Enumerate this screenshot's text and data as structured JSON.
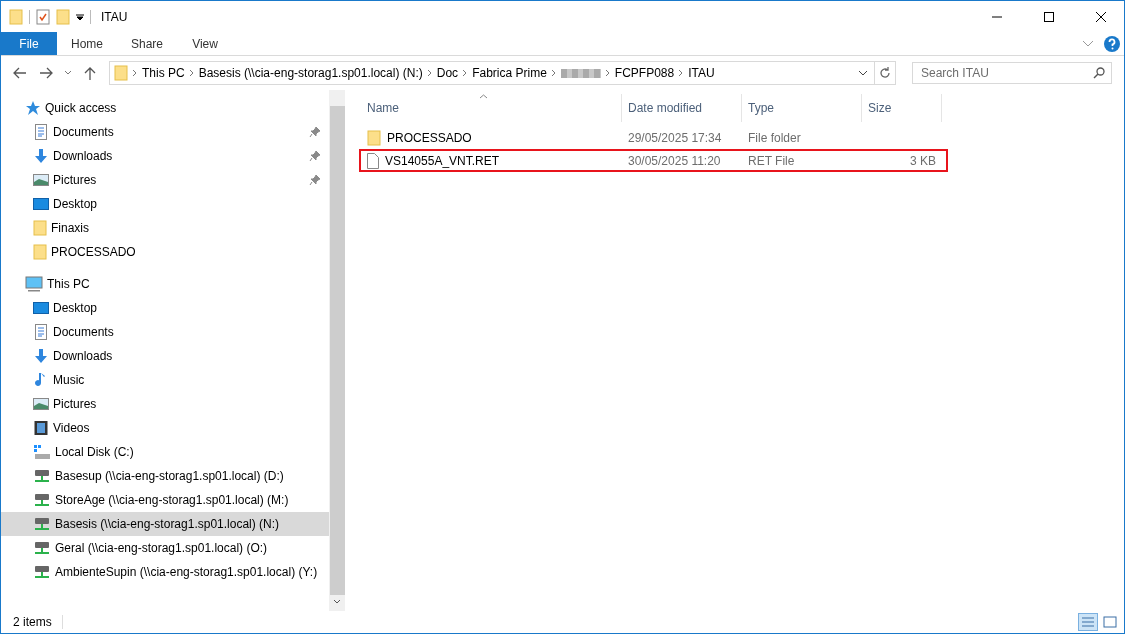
{
  "window": {
    "title": "ITAU"
  },
  "ribbon_tabs": [
    {
      "label": "File",
      "selected": true
    },
    {
      "label": "Home",
      "selected": false
    },
    {
      "label": "Share",
      "selected": false
    },
    {
      "label": "View",
      "selected": false
    }
  ],
  "breadcrumb": [
    {
      "kind": "text",
      "label": "This PC"
    },
    {
      "kind": "text",
      "label": "Basesis (\\\\cia-eng-storag1.sp01.local) (N:)"
    },
    {
      "kind": "text",
      "label": "Doc"
    },
    {
      "kind": "text",
      "label": "Fabrica Prime"
    },
    {
      "kind": "redacted"
    },
    {
      "kind": "text",
      "label": "FCPFP088"
    },
    {
      "kind": "text",
      "label": "ITAU"
    }
  ],
  "search": {
    "placeholder": "Search ITAU"
  },
  "sidebar": {
    "groups": [
      {
        "label": "Quick access",
        "kind": "star",
        "children": [
          {
            "label": "Documents",
            "kind": "documents",
            "pinned": true,
            "selected": false
          },
          {
            "label": "Downloads",
            "kind": "downloads",
            "pinned": true,
            "selected": false
          },
          {
            "label": "Pictures",
            "kind": "pictures",
            "pinned": true,
            "selected": false
          },
          {
            "label": "Desktop",
            "kind": "desktop",
            "pinned": false,
            "selected": false
          },
          {
            "label": "Finaxis",
            "kind": "folder",
            "pinned": false,
            "selected": false
          },
          {
            "label": "PROCESSADO",
            "kind": "folder",
            "pinned": false,
            "selected": false
          }
        ]
      },
      {
        "label": "This PC",
        "kind": "pc",
        "children": [
          {
            "label": "Desktop",
            "kind": "desktop",
            "pinned": false,
            "selected": false
          },
          {
            "label": "Documents",
            "kind": "documents",
            "pinned": false,
            "selected": false
          },
          {
            "label": "Downloads",
            "kind": "downloads",
            "pinned": false,
            "selected": false
          },
          {
            "label": "Music",
            "kind": "music",
            "pinned": false,
            "selected": false
          },
          {
            "label": "Pictures",
            "kind": "pictures",
            "pinned": false,
            "selected": false
          },
          {
            "label": "Videos",
            "kind": "videos",
            "pinned": false,
            "selected": false
          },
          {
            "label": "Local Disk (C:)",
            "kind": "disk",
            "pinned": false,
            "selected": false
          },
          {
            "label": "Basesup (\\\\cia-eng-storag1.sp01.local) (D:)",
            "kind": "netdrive",
            "pinned": false,
            "selected": false
          },
          {
            "label": "StoreAge (\\\\cia-eng-storag1.sp01.local) (M:)",
            "kind": "netdrive",
            "pinned": false,
            "selected": false
          },
          {
            "label": "Basesis (\\\\cia-eng-storag1.sp01.local) (N:)",
            "kind": "netdrive",
            "pinned": false,
            "selected": true
          },
          {
            "label": "Geral (\\\\cia-eng-storag1.sp01.local) (O:)",
            "kind": "netdrive",
            "pinned": false,
            "selected": false
          },
          {
            "label": "AmbienteSupin (\\\\cia-eng-storag1.sp01.local) (Y:)",
            "kind": "netdrive",
            "pinned": false,
            "selected": false
          }
        ]
      }
    ]
  },
  "table": {
    "columns": [
      "Name",
      "Date modified",
      "Type",
      "Size"
    ],
    "rows": [
      {
        "kind": "folder",
        "name": "PROCESSADO",
        "date": "29/05/2025 17:34",
        "type": "File folder",
        "highlighted": false
      },
      {
        "kind": "file",
        "name": "VS14055A_VNT.RET",
        "date": "30/05/2025 11:20",
        "type": "RET File",
        "size": "3 KB",
        "highlighted": true
      }
    ]
  },
  "status_bar": {
    "count": "2 items"
  }
}
